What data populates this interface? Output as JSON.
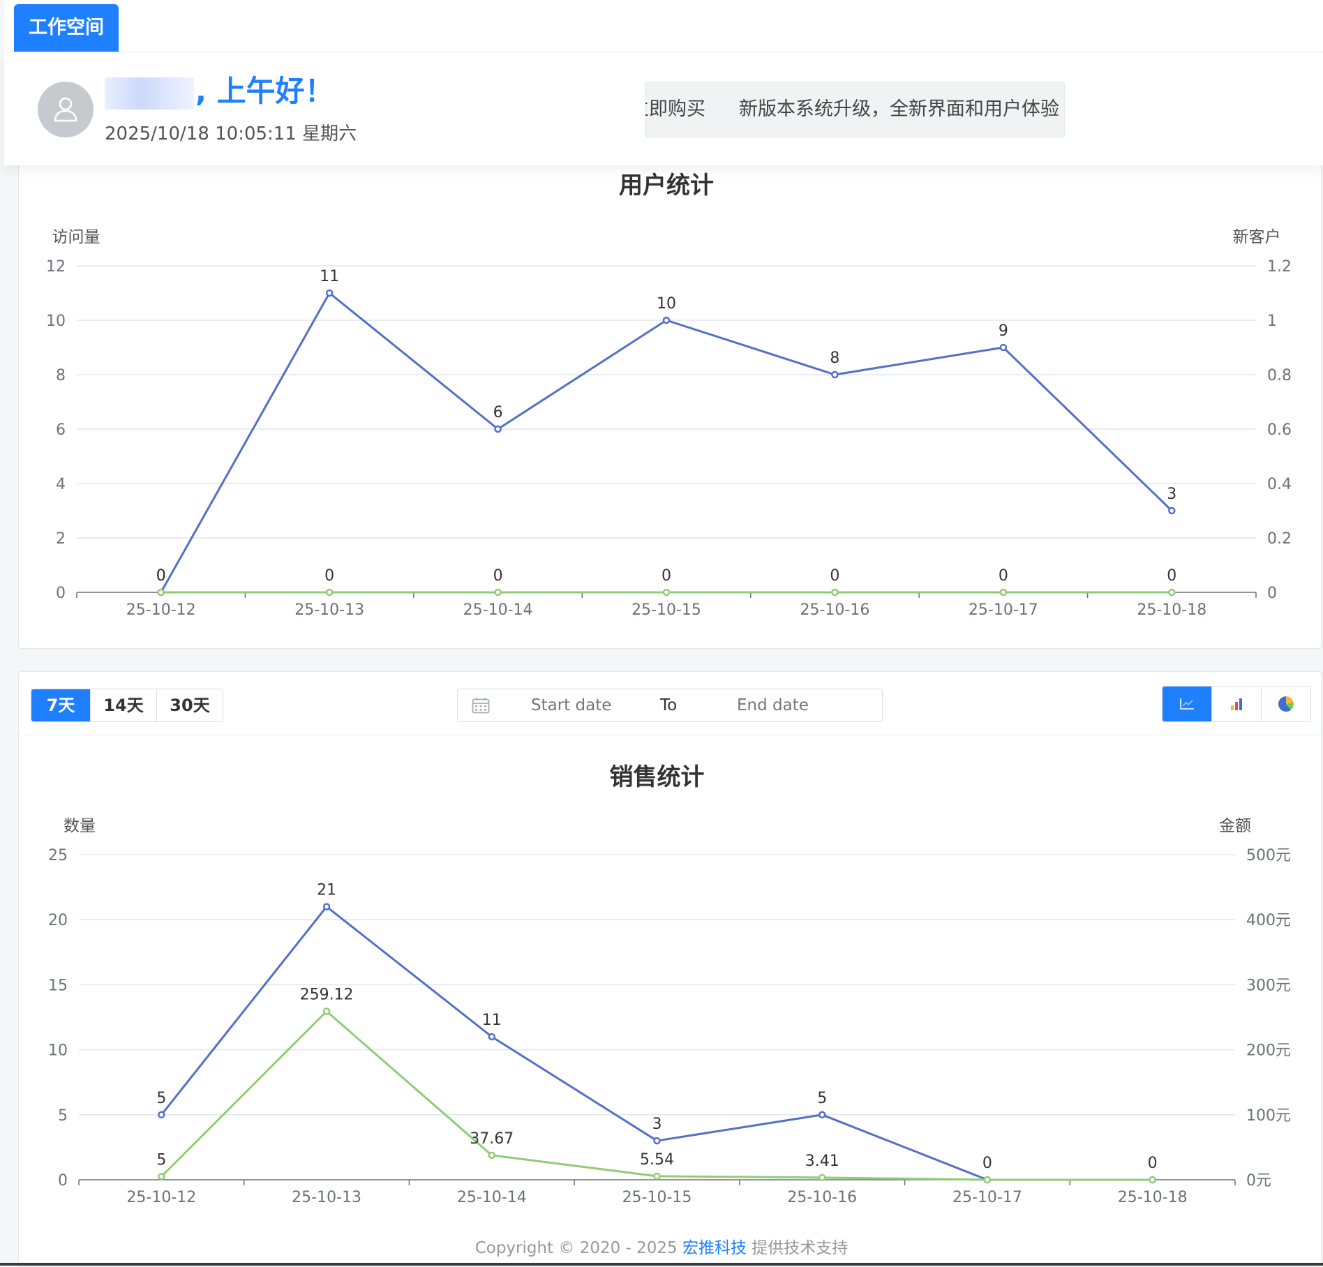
{
  "tabbar": {
    "active_tab": "工作空间"
  },
  "header": {
    "greeting_suffix": ", 上午好！",
    "datetime": "2025/10/18 10:05:11 星期六",
    "notices": [
      "立即购买",
      "新版本系统升级，全新界面和用户体验"
    ]
  },
  "filter": {
    "ranges": [
      "7天",
      "14天",
      "30天"
    ],
    "active_range": "7天",
    "start_placeholder": "Start date",
    "separator": "To",
    "end_placeholder": "End date",
    "chart_types": [
      "line-chart-icon",
      "bar-chart-icon",
      "pie-chart-icon"
    ],
    "active_chart_type": "line-chart-icon"
  },
  "chart_data": [
    {
      "type": "line",
      "title": "用户统计",
      "ylabel_left": "访问量",
      "ylabel_right": "新客户",
      "categories": [
        "25-10-12",
        "25-10-13",
        "25-10-14",
        "25-10-15",
        "25-10-16",
        "25-10-17",
        "25-10-18"
      ],
      "y_left_ticks": [
        "0",
        "2",
        "4",
        "6",
        "8",
        "10",
        "12"
      ],
      "y_right_ticks": [
        "0",
        "0.2",
        "0.4",
        "0.6",
        "0.8",
        "1",
        "1.2"
      ],
      "ylim_left": [
        0,
        12
      ],
      "ylim_right": [
        0,
        1.2
      ],
      "grid": true,
      "series": [
        {
          "axis": "left",
          "color": "#5470c6",
          "values": [
            0,
            11,
            6,
            10,
            8,
            9,
            3
          ],
          "labels": [
            "0",
            "11",
            "6",
            "10",
            "8",
            "9",
            "3"
          ]
        },
        {
          "axis": "right",
          "color": "#91cc75",
          "values": [
            0,
            0,
            0,
            0,
            0,
            0,
            0
          ],
          "labels": [
            "0",
            "0",
            "0",
            "0",
            "0",
            "0",
            "0"
          ]
        }
      ]
    },
    {
      "type": "line",
      "title": "销售统计",
      "ylabel_left": "数量",
      "ylabel_right": "金额",
      "categories": [
        "25-10-12",
        "25-10-13",
        "25-10-14",
        "25-10-15",
        "25-10-16",
        "25-10-17",
        "25-10-18"
      ],
      "y_left_ticks": [
        "0",
        "5",
        "10",
        "15",
        "20",
        "25"
      ],
      "y_right_ticks": [
        "0元",
        "100元",
        "200元",
        "300元",
        "400元",
        "500元"
      ],
      "ylim_left": [
        0,
        25
      ],
      "ylim_right": [
        0,
        500
      ],
      "grid": true,
      "series": [
        {
          "axis": "left",
          "color": "#5470c6",
          "values": [
            5,
            21,
            11,
            3,
            5,
            0,
            0
          ],
          "labels": [
            "5",
            "21",
            "11",
            "3",
            "5",
            "0",
            "0"
          ]
        },
        {
          "axis": "right",
          "color": "#91cc75",
          "values": [
            5,
            259.12,
            37.67,
            5.54,
            3.41,
            0,
            0
          ],
          "labels": [
            "5",
            "259.12",
            "37.67",
            "5.54",
            "3.41",
            "",
            ""
          ]
        }
      ]
    }
  ],
  "footer": {
    "prefix": "Copyright © 2020 - 2025 ",
    "brand": "宏推科技",
    "suffix": " 提供技术支持"
  }
}
